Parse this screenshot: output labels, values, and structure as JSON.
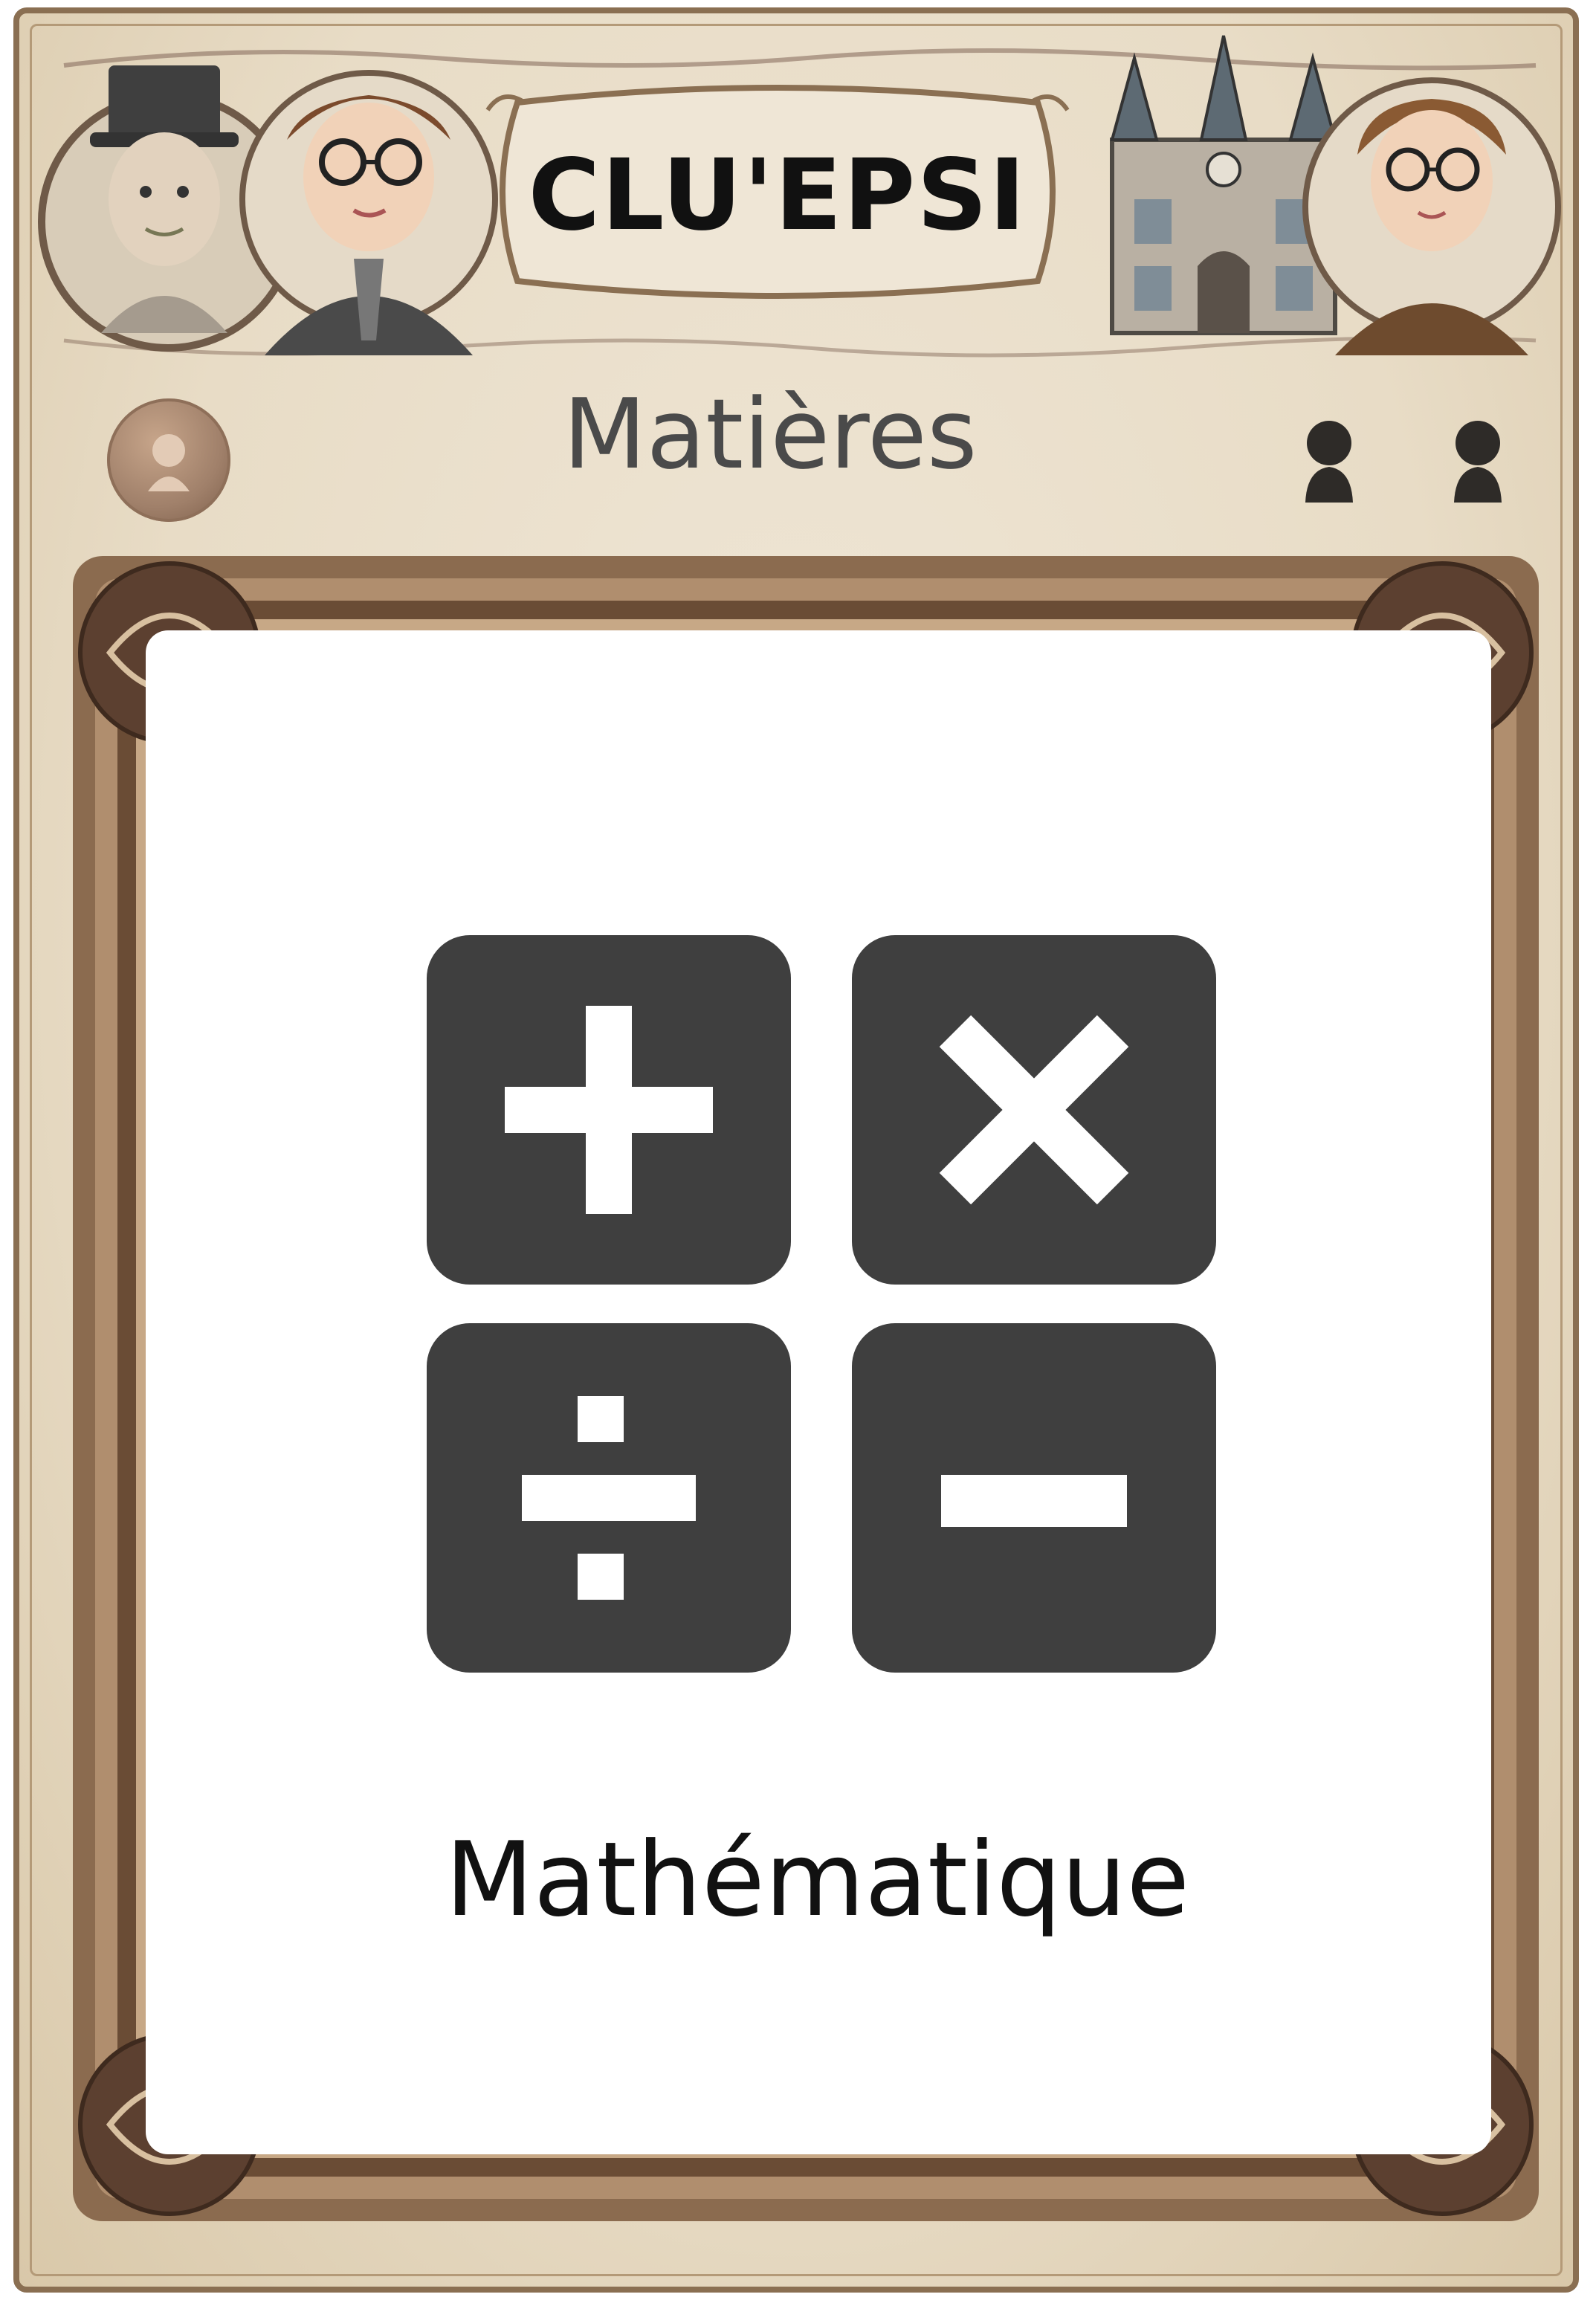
{
  "card": {
    "title": "CLU'EPSI",
    "category": "Matières",
    "subject": "Mathématique"
  },
  "header": {
    "left_portraits": [
      "gentleman-top-hat-portrait",
      "boy-with-glasses-portrait"
    ],
    "right_images": [
      "castle-school-illustration",
      "student-with-glasses-portrait"
    ],
    "player_icons": [
      "player-silhouette-icon",
      "player-silhouette-icon"
    ],
    "token_icon": "player-token-icon"
  },
  "illustration": {
    "tiles": [
      "plus-icon",
      "multiply-icon",
      "divide-icon",
      "minus-icon"
    ],
    "tile_color": "#3f3f3f",
    "glyph_color": "#ffffff"
  },
  "colors": {
    "card_background": "#e8dcc6",
    "frame_brown": "#7a5a40",
    "content_background": "#ffffff"
  }
}
